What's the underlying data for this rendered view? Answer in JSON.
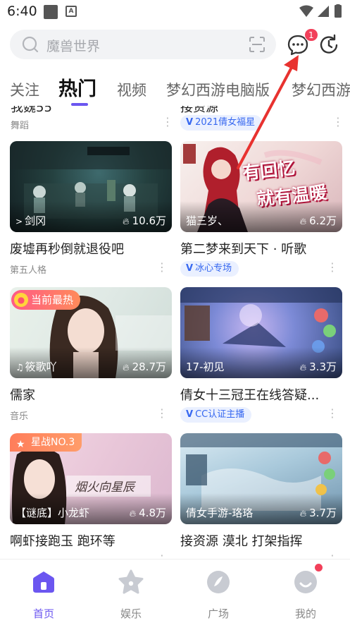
{
  "status_bar": {
    "time": "6:40",
    "a_label": "A"
  },
  "search": {
    "placeholder": "魔兽世界",
    "message_badge_count": "1"
  },
  "tabs": [
    {
      "label": "关注",
      "active": false
    },
    {
      "label": "热门",
      "active": true
    },
    {
      "label": "视频",
      "active": false
    },
    {
      "label": "梦幻西游电脑版",
      "active": false
    },
    {
      "label": "梦幻西游",
      "active": false
    }
  ],
  "peek_row": {
    "left": {
      "title": "我魏55",
      "category": "舞蹈"
    },
    "right": {
      "title": "接资源",
      "tag": "2021倩女福星"
    }
  },
  "cards": [
    {
      "host": "剑冈",
      "views": "10.6万",
      "title": "废墟再秒倒就退役吧",
      "category": "第五人格",
      "tag": ""
    },
    {
      "host": "猫三岁、",
      "views": "6.2万",
      "title": "第二梦来到天下 · 听歌",
      "category": "",
      "tag": "冰心专场",
      "overlay_text_1": "有回忆",
      "overlay_text_2": "就有温暖"
    },
    {
      "host": "筱歌吖",
      "views": "28.7万",
      "title": "儒家",
      "category": "音乐",
      "tag": "",
      "badge": "当前最热"
    },
    {
      "host": "17-初见",
      "views": "3.3万",
      "title": "倩女十三冠王在线答疑...",
      "category": "",
      "tag": "CC认证主播"
    },
    {
      "host": "【谜底】小龙虾",
      "views": "4.8万",
      "title": "啊虾接跑玉 跑环等",
      "category": "",
      "tag": "",
      "badge": "星战NO.3",
      "overlay_text": "烟火向星辰"
    },
    {
      "host": "倩女手游-珞珞",
      "views": "3.7万",
      "title": "接资源 漠北 打架指挥",
      "category": "",
      "tag": ""
    }
  ],
  "bottom_nav": [
    {
      "label": "首页",
      "icon": "home-icon",
      "active": true
    },
    {
      "label": "娱乐",
      "icon": "star-icon",
      "active": false
    },
    {
      "label": "广场",
      "icon": "compass-icon",
      "active": false
    },
    {
      "label": "我的",
      "icon": "profile-icon",
      "active": false
    }
  ],
  "colors": {
    "accent": "#6b56f0",
    "badge_red": "#f2405a",
    "tag_blue": "#3768f0",
    "annotation_arrow": "#e8322f"
  }
}
